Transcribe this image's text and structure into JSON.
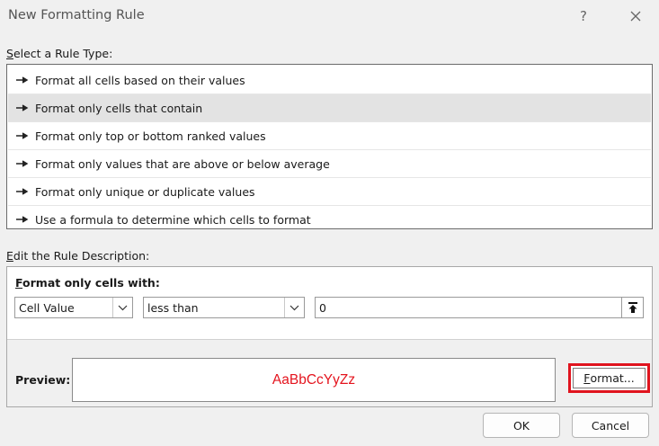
{
  "dialog": {
    "title": "New Formatting Rule",
    "help_label": "?"
  },
  "rule_type": {
    "label_prefix": "S",
    "label_rest": "elect a Rule Type:",
    "selected_index": 1,
    "items": [
      {
        "label": "Format all cells based on their values"
      },
      {
        "label": "Format only cells that contain"
      },
      {
        "label": "Format only top or bottom ranked values"
      },
      {
        "label": "Format only values that are above or below average"
      },
      {
        "label": "Format only unique or duplicate values"
      },
      {
        "label": "Use a formula to determine which cells to format"
      }
    ]
  },
  "description": {
    "label_prefix": "E",
    "label_rest": "dit the Rule Description:",
    "format_header_prefix": "F",
    "format_header_rest": "ormat only cells with:",
    "condition_type": "Cell Value",
    "operator": "less than",
    "value": "0",
    "preview_label": "Preview:",
    "preview_text": "AaBbCcYyZz",
    "format_button_prefix": "F",
    "format_button_rest": "ormat..."
  },
  "buttons": {
    "ok": "OK",
    "cancel": "Cancel"
  },
  "colors": {
    "preview_text": "#e4141e",
    "highlight_border": "#e0141e",
    "selected_row": "#e3e3e3"
  }
}
